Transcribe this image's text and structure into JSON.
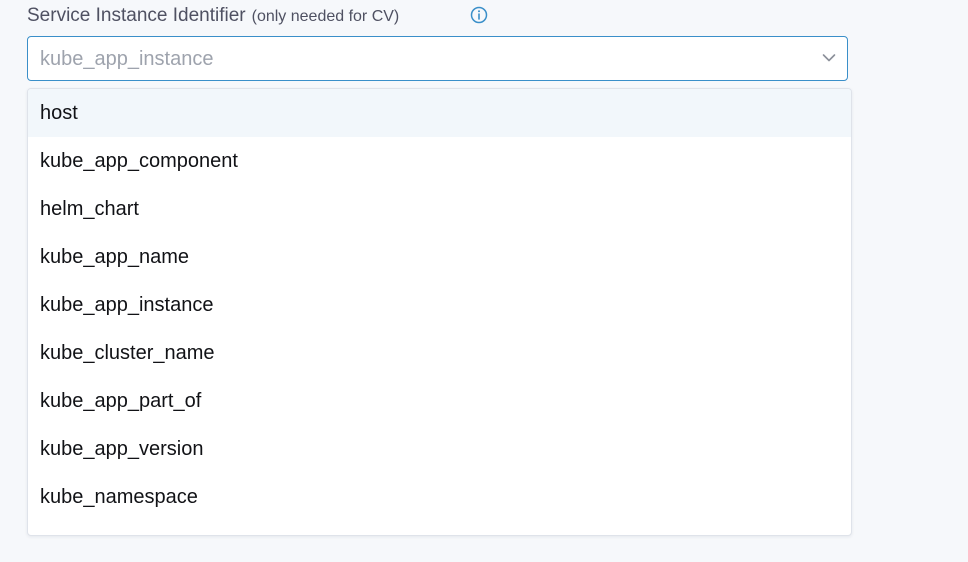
{
  "field": {
    "label": "Service Instance Identifier",
    "label_hint": "(only needed for CV)",
    "info_icon": "info-icon",
    "selected_value": "kube_app_instance",
    "chevron_icon": "chevron-down-icon"
  },
  "dropdown": {
    "options": [
      {
        "label": "host",
        "highlighted": true
      },
      {
        "label": "kube_app_component",
        "highlighted": false
      },
      {
        "label": "helm_chart",
        "highlighted": false
      },
      {
        "label": "kube_app_name",
        "highlighted": false
      },
      {
        "label": "kube_app_instance",
        "highlighted": false
      },
      {
        "label": "kube_cluster_name",
        "highlighted": false
      },
      {
        "label": "kube_app_part_of",
        "highlighted": false
      },
      {
        "label": "kube_app_version",
        "highlighted": false
      },
      {
        "label": "kube_namespace",
        "highlighted": false
      }
    ]
  },
  "colors": {
    "accent": "#3a8fc9",
    "highlight_bg": "#f2f7fb",
    "label_text": "#4f5162",
    "placeholder_text": "#9ea3ad"
  }
}
